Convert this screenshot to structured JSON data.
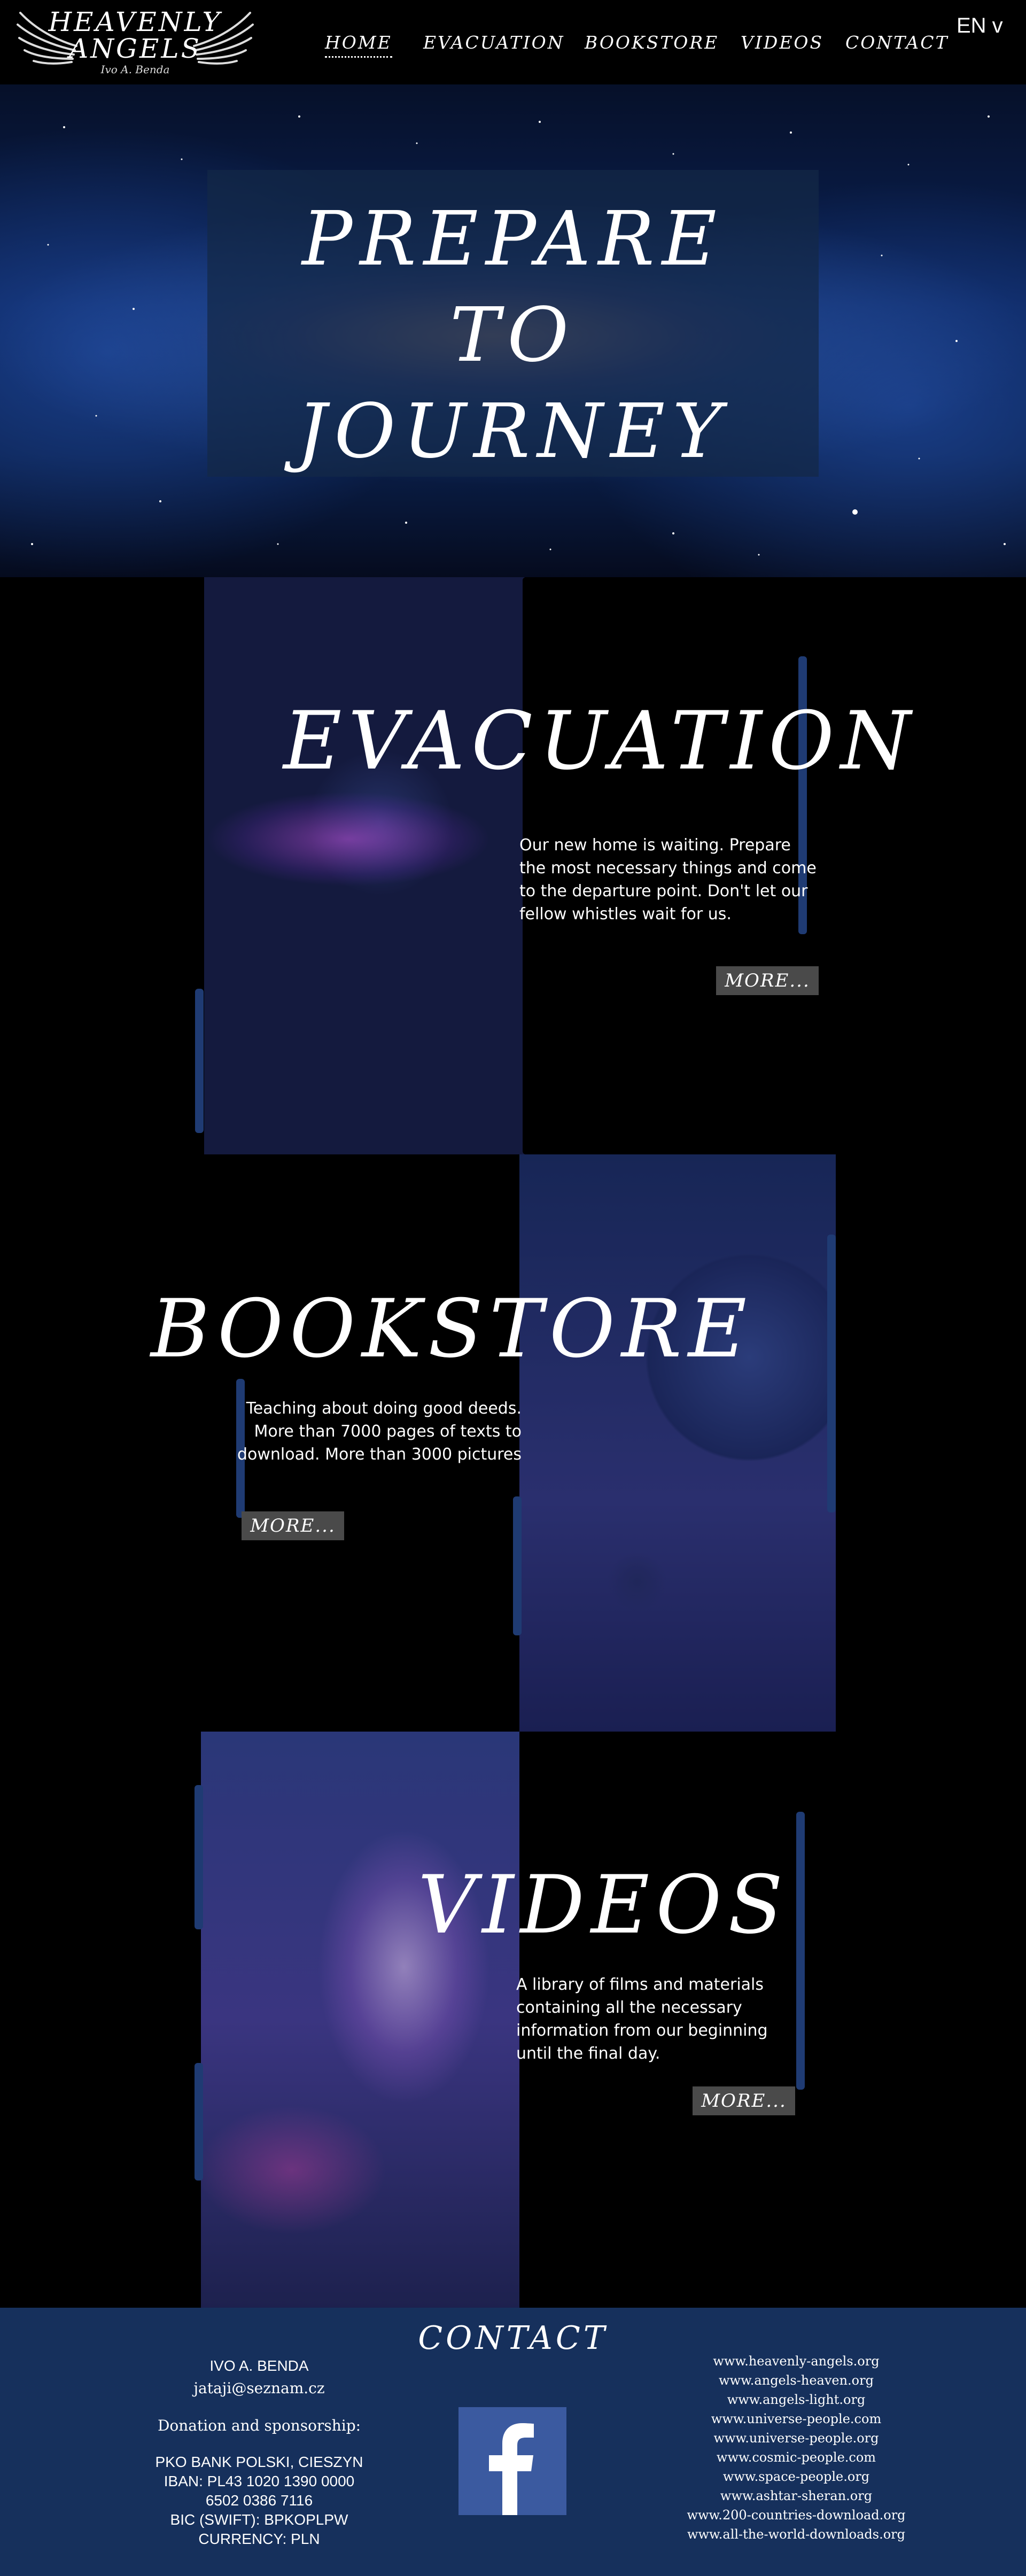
{
  "header": {
    "logo": {
      "line1": "HEAVENLY",
      "line2": "ANGELS",
      "author": "Ivo A. Benda"
    },
    "nav": [
      {
        "label": "Home",
        "active": true
      },
      {
        "label": "Evacuation"
      },
      {
        "label": "Bookstore"
      },
      {
        "label": "Videos"
      },
      {
        "label": "Contact"
      }
    ],
    "language": "EN v"
  },
  "hero": {
    "line1": "PREPARE",
    "line2": "TO",
    "line3": "JOURNEY"
  },
  "evacuation": {
    "title": "Evacuation",
    "text": "Our new home is waiting. Prepare the most necessary things and come to the departure point. Don't let our fellow whistles wait for us.",
    "button": "More..."
  },
  "bookstore": {
    "title": "Bookstore",
    "text": "Teaching about doing good deeds. More than 7000 pages of texts to download. More than 3000 pictures",
    "button": "More..."
  },
  "videos": {
    "title": "Videos",
    "text": "A library of films and materials containing all the necessary information from our beginning until the final day.",
    "button": "More..."
  },
  "footer": {
    "title": "Contact",
    "name": "IVO A. BENDA",
    "email": "jataji@seznam.cz",
    "donation": "Donation and sponsorship:",
    "bank": "PKO BANK POLSKI, CIESZYN",
    "iban": "IBAN: PL43 1020 1390 0000",
    "iban2": "6502 0386 7116",
    "bic": "BIC (SWIFT): BPKOPLPW",
    "currency": "CURRENCY: PLN",
    "facebook_icon": "facebook-icon",
    "links": [
      "www.heavenly-angels.org",
      "www.angels-heaven.org",
      "www.angels-light.org",
      "www.universe-people.com",
      "www.universe-people.org",
      "www.cosmic-people.com",
      "www.space-people.org",
      "www.ashtar-sheran.org",
      "www.200-countries-download.org",
      "www.all-the-world-downloads.org"
    ]
  },
  "colors": {
    "accent": "#1f3b73",
    "footer_bg": "#16305c",
    "button_bg": "#4a4a4a"
  }
}
